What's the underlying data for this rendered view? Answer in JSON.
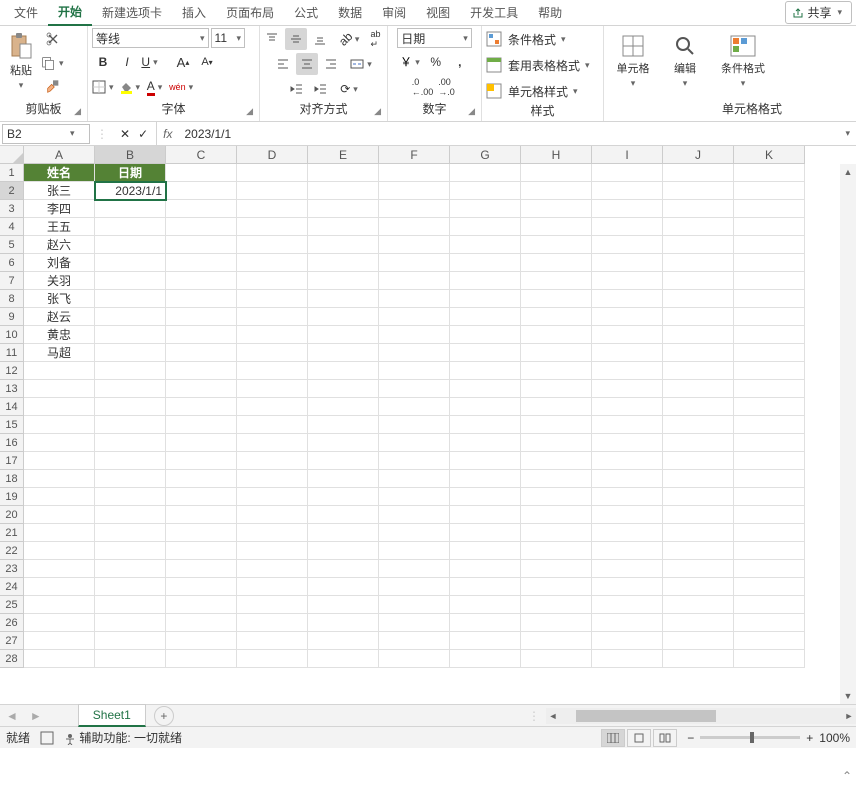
{
  "tabs": {
    "file": "文件",
    "home": "开始",
    "newtab": "新建选项卡",
    "insert": "插入",
    "layout": "页面布局",
    "formulas": "公式",
    "data": "数据",
    "review": "审阅",
    "view": "视图",
    "dev": "开发工具",
    "help": "帮助"
  },
  "share": "共享",
  "ribbon": {
    "clipboard": {
      "label": "剪贴板",
      "paste": "粘贴"
    },
    "font": {
      "label": "字体",
      "name": "等线",
      "size": "11"
    },
    "align": {
      "label": "对齐方式"
    },
    "number": {
      "label": "数字",
      "format": "日期"
    },
    "styles": {
      "label": "样式",
      "cond": "条件格式",
      "table": "套用表格格式",
      "cell": "单元格样式",
      "condfmt": "条件格式"
    },
    "cells": {
      "label": "单元格格式",
      "cellbtn": "单元格",
      "edit": "编辑"
    }
  },
  "namebox": "B2",
  "formula": "2023/1/1",
  "colheads": [
    "A",
    "B",
    "C",
    "D",
    "E",
    "F",
    "G",
    "H",
    "I",
    "J",
    "K"
  ],
  "rowcount": 28,
  "headers": {
    "a1": "姓名",
    "b1": "日期"
  },
  "names": [
    "张三",
    "李四",
    "王五",
    "赵六",
    "刘备",
    "关羽",
    "张飞",
    "赵云",
    "黄忠",
    "马超"
  ],
  "b2": "2023/1/1",
  "sheet": "Sheet1",
  "status": {
    "ready": "就绪",
    "acc": "辅助功能: 一切就绪",
    "zoom": "100%"
  }
}
